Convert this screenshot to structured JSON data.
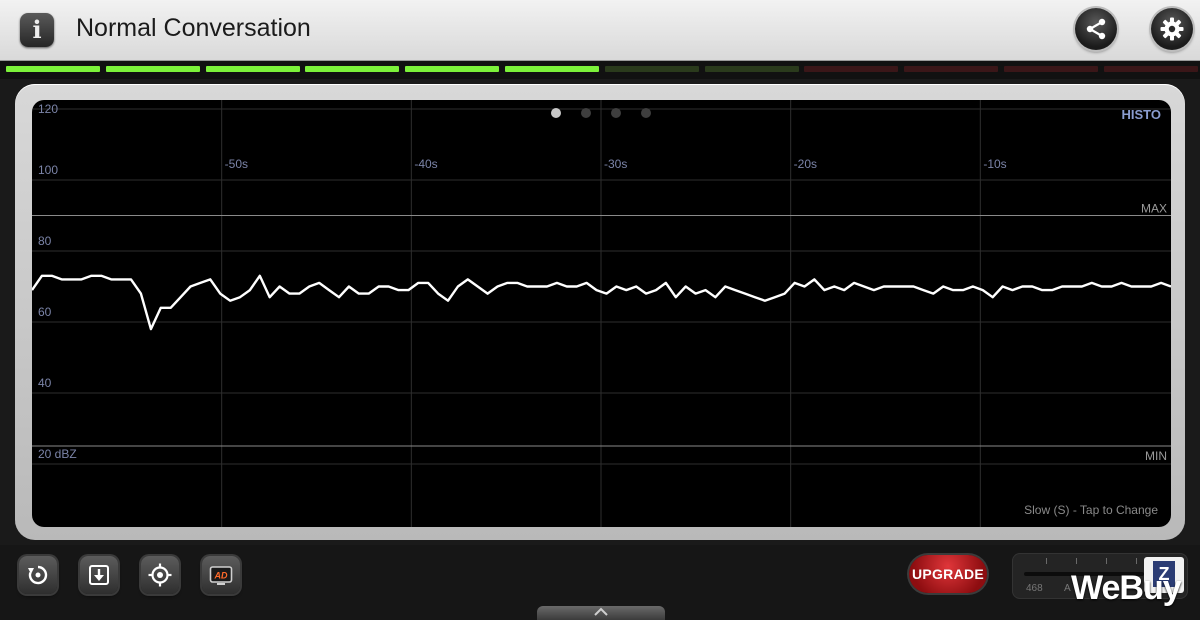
{
  "header": {
    "info_icon": "info-icon",
    "info_label": "i",
    "title": "Normal Conversation",
    "share_icon": "share-icon",
    "settings_icon": "gear-icon"
  },
  "level_meter": {
    "segments_total": 12,
    "segments_lit": 6,
    "colors": {
      "lit": "#7cf23a",
      "unlit_green": "#2a3a1c",
      "unlit_red": "#3a1618"
    }
  },
  "graph": {
    "mode_label": "HISTO",
    "page_dots": 4,
    "active_dot": 0,
    "footnote": "Slow (S) - Tap to Change",
    "y_labels": [
      "120",
      "100",
      "80",
      "60",
      "40",
      "20 dBZ"
    ],
    "x_labels": [
      "-50s",
      "-40s",
      "-30s",
      "-20s",
      "-10s"
    ],
    "max_label": "MAX",
    "min_label": "MIN",
    "colors": {
      "line": "#ffffff",
      "grid": "#2e2e2e",
      "axis_text": "#7b84a8",
      "minmax_line": "#8a8a8a"
    }
  },
  "chart_data": {
    "type": "line",
    "x_range_seconds": [
      -60,
      0
    ],
    "ylim": [
      20,
      120
    ],
    "max_threshold": 90,
    "min_threshold": 20,
    "series": [
      {
        "values": [
          69,
          73,
          73,
          72,
          72,
          72,
          73,
          73,
          72,
          72,
          72,
          68,
          58,
          64,
          64,
          67,
          70,
          71,
          72,
          68,
          66,
          67,
          69,
          73,
          67,
          70,
          68,
          68,
          70,
          71,
          69,
          67,
          70,
          68,
          68,
          70,
          70,
          69,
          69,
          71,
          71,
          68,
          66,
          70,
          72,
          70,
          68,
          70,
          71,
          71,
          70,
          70,
          70,
          71,
          70,
          70,
          71,
          69,
          68,
          70,
          69,
          70,
          68,
          69,
          71,
          67,
          70,
          68,
          69,
          67,
          70,
          69,
          68,
          67,
          66,
          67,
          68,
          71,
          70,
          72,
          69,
          70,
          69,
          71,
          70,
          69,
          70,
          70,
          70,
          70,
          69,
          68,
          70,
          69,
          69,
          70,
          69,
          67,
          70,
          69,
          70,
          70,
          69,
          69,
          70,
          70,
          70,
          71,
          70,
          70,
          71,
          70,
          70,
          70,
          71,
          70
        ]
      }
    ]
  },
  "toolbar": {
    "reset_icon": "reset-icon",
    "save_icon": "download-icon",
    "calibrate_icon": "crosshair-icon",
    "ad_label": "AD",
    "upgrade_label": "UPGRADE",
    "zoom_values": [
      "468",
      "A"
    ],
    "zoom_label": "Z"
  },
  "watermark": "WeBuy"
}
